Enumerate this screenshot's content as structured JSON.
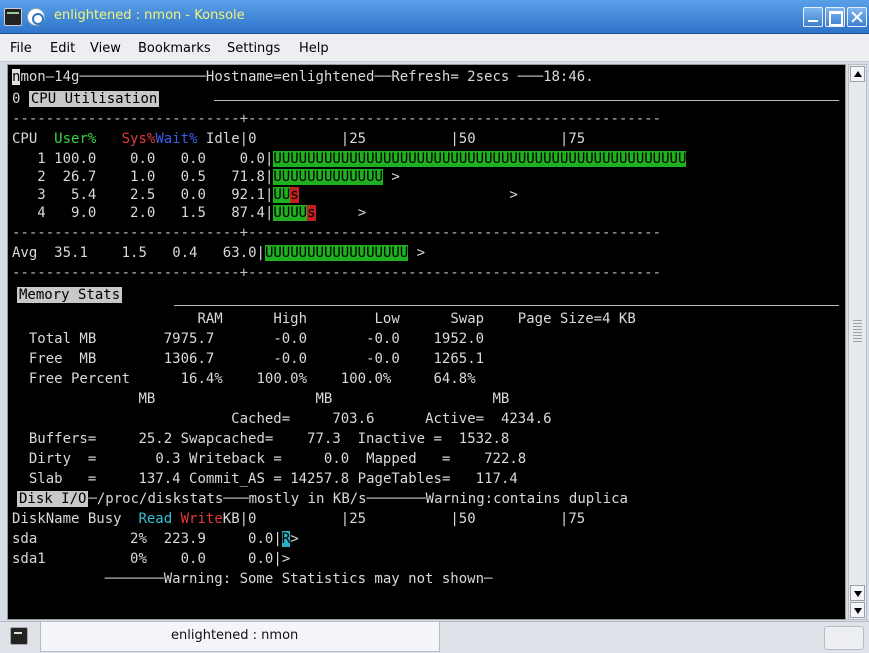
{
  "window": {
    "title": "enlightened : nmon - Konsole"
  },
  "menu": [
    "File",
    "Edit",
    "View",
    "Bookmarks",
    "Settings",
    "Help"
  ],
  "tab": {
    "label": "enlightened : nmon"
  },
  "terminal": {
    "top_line": {
      "cursor": "n",
      "text": "mon—14g",
      "hostname": "Hostname=enlightened",
      "refresh": "Refresh= 2secs",
      "time": "18:46."
    },
    "cpu": {
      "row_prefix": "0",
      "header": "CPU Utilisation",
      "dashes": "---------------------------+-------------------------------------------------",
      "col_cpu": "CPU",
      "col_user": "User%",
      "col_sys": "Sys%",
      "col_wait": "Wait%",
      "col_idle": "Idle",
      "scale": "|0          |25          |50          |75",
      "rows": [
        {
          "cpu": "1",
          "user": "100.0",
          "sys": "0.0",
          "wait": "0.0",
          "idle": "0.0",
          "bar_u": "UUUUUUUUUUUUUUUUUUUUUUUUUUUUUUUUUUUUUUUUUUUUUUUUU",
          "bar_s": "",
          "tail": ""
        },
        {
          "cpu": "2",
          "user": "26.7",
          "sys": "1.0",
          "wait": "0.5",
          "idle": "71.8",
          "bar_u": "UUUUUUUUUUUUU",
          "bar_s": "",
          "tail": " >"
        },
        {
          "cpu": "3",
          "user": "5.4",
          "sys": "2.5",
          "wait": "0.0",
          "idle": "92.1",
          "bar_u": "UU",
          "bar_s": "s",
          "tail": "                         >"
        },
        {
          "cpu": "4",
          "user": "9.0",
          "sys": "2.0",
          "wait": "1.5",
          "idle": "87.4",
          "bar_u": "UUUU",
          "bar_s": "s",
          "tail": "     >"
        }
      ],
      "avg": {
        "label": "Avg",
        "user": "35.1",
        "sys": "1.5",
        "wait": "0.4",
        "idle": "63.0",
        "bar_u": "UUUUUUUUUUUUUUUUU",
        "tail": " >"
      }
    },
    "memory": {
      "header": "Memory Stats",
      "cols": [
        "RAM",
        "High",
        "Low",
        "Swap",
        "Page Size=4 KB"
      ],
      "rows": [
        {
          "label": "Total MB",
          "ram": "7975.7",
          "high": "-0.0",
          "low": "-0.0",
          "swap": "1952.0"
        },
        {
          "label": "Free  MB",
          "ram": "1306.7",
          "high": "-0.0",
          "low": "-0.0",
          "swap": "1265.1"
        },
        {
          "label": "Free Percent",
          "ram": "16.4%",
          "high": "100.0%",
          "low": "100.0%",
          "swap": "64.8%"
        }
      ],
      "mb_headers": [
        "MB",
        "MB",
        "MB"
      ],
      "detail": [
        [
          "",
          "",
          "Cached=",
          "703.6",
          "Active=",
          "4234.6"
        ],
        [
          "Buffers=",
          "25.2",
          "Swapcached=",
          "77.3",
          "Inactive =",
          "1532.8"
        ],
        [
          "Dirty  =",
          "0.3",
          "Writeback =",
          "0.0",
          "Mapped   =",
          "722.8"
        ],
        [
          "Slab   =",
          "137.4",
          "Commit_AS =",
          "14257.8",
          "PageTables=",
          "117.4"
        ]
      ]
    },
    "disk": {
      "header": "Disk I/O",
      "path": "/proc/diskstats",
      "note": "mostly in KB/s",
      "warning_dup": "Warning:contains duplica",
      "col_name": "DiskName",
      "col_busy": "Busy",
      "col_read": "Read",
      "col_write": "Write",
      "col_kb": "KB",
      "scale": "|0          |25          |50          |75",
      "rows": [
        {
          "name": "sda",
          "busy": "2%",
          "read": "223.9",
          "write": "0.0",
          "bar": "R",
          "tail": ">"
        },
        {
          "name": "sda1",
          "busy": "0%",
          "read": "0.0",
          "write": "0.0",
          "bar": "",
          "tail": ">"
        }
      ]
    },
    "footer_warning": "Warning: Some Statistics may not shown"
  },
  "colors": {
    "user": "#39d43b",
    "sys": "#e13a3a",
    "wait": "#3b5de7",
    "read": "#35c2d6",
    "title_text": "#f0f57a"
  }
}
